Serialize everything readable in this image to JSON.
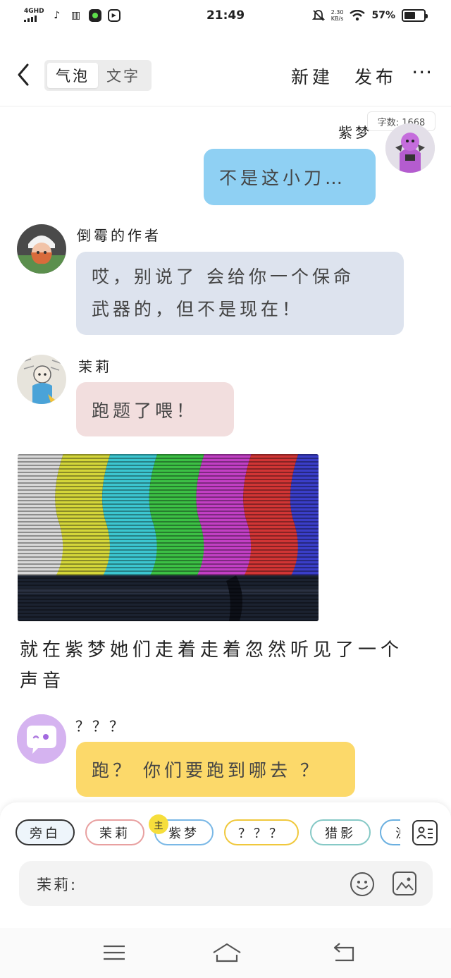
{
  "status_bar": {
    "network": "4GHD",
    "time": "21:49",
    "speed_value": "2.30",
    "speed_unit": "KB/s",
    "battery": "57%",
    "battery_level": 0.57
  },
  "header": {
    "tabs": [
      "气泡",
      "文字"
    ],
    "active_tab": 0,
    "new_label": "新建",
    "publish_label": "发布",
    "more_label": "···"
  },
  "word_count": "字数: 1668",
  "messages": [
    {
      "speaker": "紫梦",
      "text": "不是这小刀…",
      "bubble_color": "#8fd0f3"
    },
    {
      "speaker": "倒霉的作者",
      "text_line1": "哎，别说了 会给你一个保命",
      "text_line2": "武器的，但不是现在！",
      "bubble_color": "#dde3ee"
    },
    {
      "speaker": "茉莉",
      "text": "跑题了喂！",
      "bubble_color": "#f2dede"
    },
    {
      "speaker": "？？？",
      "text": "跑？ 你们要跑到哪去 ？",
      "bubble_color": "#fcd96a"
    }
  ],
  "narration_line1": "就在紫梦她们走着走着忽然听见了一个",
  "narration_line2": "声音",
  "roles": [
    {
      "label": "旁白",
      "border": "#333333"
    },
    {
      "label": "茉莉",
      "border": "#e8a0a0"
    },
    {
      "label": "紫梦",
      "border": "#7ab8e6"
    },
    {
      "label": "？？？",
      "border": "#f0c83c"
    },
    {
      "label": "猎影",
      "border": "#86c9c6"
    },
    {
      "label": "浊",
      "border": "#6bb0e0"
    }
  ],
  "host_badge": "主",
  "input": {
    "label": "茉莉:"
  },
  "colors": {
    "accent": "#f6de3c",
    "tv_bars": [
      "#d8d8d8",
      "#d4d63a",
      "#3cc6d0",
      "#3cc045",
      "#c23fc4",
      "#d13535",
      "#3a3ec8"
    ]
  }
}
